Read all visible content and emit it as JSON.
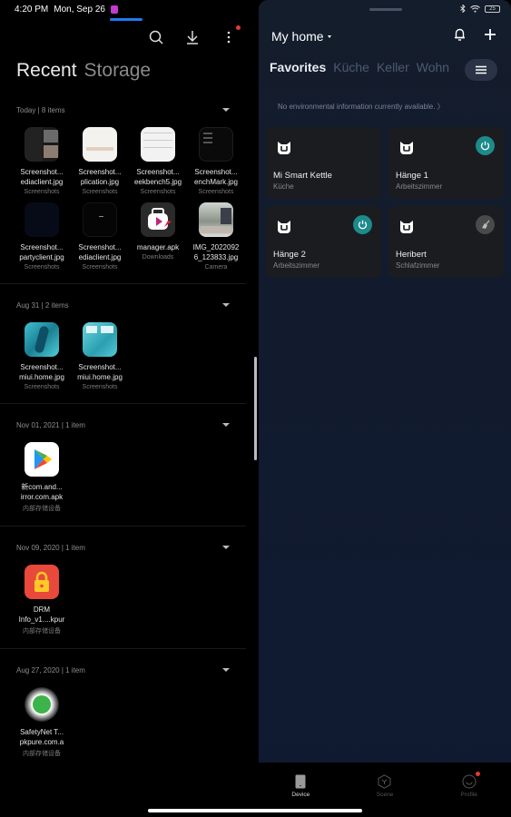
{
  "left_pane": {
    "status_bar": {
      "time": "4:20 PM",
      "date": "Mon, Sep 26"
    },
    "toolbar": {
      "icons": [
        "search-icon",
        "download-icon",
        "more-vert-icon"
      ]
    },
    "tabs": [
      {
        "label": "Recent",
        "active": true
      },
      {
        "label": "Storage",
        "active": false
      }
    ],
    "groups": [
      {
        "title": "Today  |  8 items",
        "files": [
          {
            "name1": "Screenshot...",
            "name2": "ediaclient.jpg",
            "location": "Screenshots",
            "thumb": "dark-screenshot"
          },
          {
            "name1": "Screenshot...",
            "name2": "plication.jpg",
            "location": "Screenshots",
            "thumb": "white-screenshot"
          },
          {
            "name1": "Screenshot...",
            "name2": "eekbench5.jpg",
            "location": "Screenshots",
            "thumb": "white-screenshot"
          },
          {
            "name1": "Screenshot...",
            "name2": "enchMark.jpg",
            "location": "Screenshots",
            "thumb": "black-screenshot"
          },
          {
            "name1": "Screenshot...",
            "name2": "partyclient.jpg",
            "location": "Screenshots",
            "thumb": "navy-screenshot"
          },
          {
            "name1": "Screenshot...",
            "name2": "ediaclient.jpg",
            "location": "Screenshots",
            "thumb": "black-screenshot"
          },
          {
            "name1": "manager.apk",
            "name2": "",
            "location": "Downloads",
            "thumb": "video-manager-app"
          },
          {
            "name1": "IMG_2022092",
            "name2": "6_123833.jpg",
            "location": "Camera",
            "thumb": "photo"
          }
        ]
      },
      {
        "title": "Aug 31  |  2 items",
        "files": [
          {
            "name1": "Screenshot...",
            "name2": "miui.home.jpg",
            "location": "Screenshots",
            "thumb": "teal-screenshot"
          },
          {
            "name1": "Screenshot...",
            "name2": "miui.home.jpg",
            "location": "Screenshots",
            "thumb": "teal-screenshot"
          }
        ]
      },
      {
        "title": "Nov 01, 2021  |  1 item",
        "files": [
          {
            "name1": "新com.and...",
            "name2": "irror.com.apk",
            "location": "内部存储设备",
            "thumb": "play-store-app"
          }
        ]
      },
      {
        "title": "Nov 09, 2020  |  1 item",
        "files": [
          {
            "name1": "DRM",
            "name2": "Info_v1....kpur",
            "location": "内部存储设备",
            "thumb": "lock-app"
          }
        ]
      },
      {
        "title": "Aug 27, 2020  |  1 item",
        "files": [
          {
            "name1": "SafetyNet T...",
            "name2": "pkpure.com.a",
            "location": "内部存储设备",
            "thumb": "safetynet-app"
          }
        ]
      }
    ]
  },
  "right_pane": {
    "status_bar": {
      "battery": "25"
    },
    "header": {
      "title": "My home"
    },
    "rooms": [
      {
        "label": "Favorites",
        "active": true
      },
      {
        "label": "Küche",
        "active": false
      },
      {
        "label": "Keller",
        "active": false
      },
      {
        "label": "Wohn",
        "active": false
      }
    ],
    "env_info": "No environmental information currently available.  〉",
    "devices": [
      {
        "name": "Mi Smart Kettle",
        "room": "Küche",
        "action": "none"
      },
      {
        "name": "Hänge 1",
        "room": "Arbeitszimmer",
        "action": "power-on"
      },
      {
        "name": "Hänge 2",
        "room": "Arbeitszimmer",
        "action": "power-on"
      },
      {
        "name": "Heribert",
        "room": "Schlafzimmer",
        "action": "vacuum-off"
      }
    ],
    "bottom_nav": [
      {
        "label": "Device",
        "icon": "device-icon",
        "active": true
      },
      {
        "label": "Scene",
        "icon": "scene-icon",
        "active": false
      },
      {
        "label": "Profile",
        "icon": "profile-icon",
        "active": false,
        "badge": true
      }
    ],
    "colors": {
      "accent_teal": "#1d8a8c",
      "badge_red": "#e53935",
      "tab_blue": "#1f7bf2"
    }
  }
}
